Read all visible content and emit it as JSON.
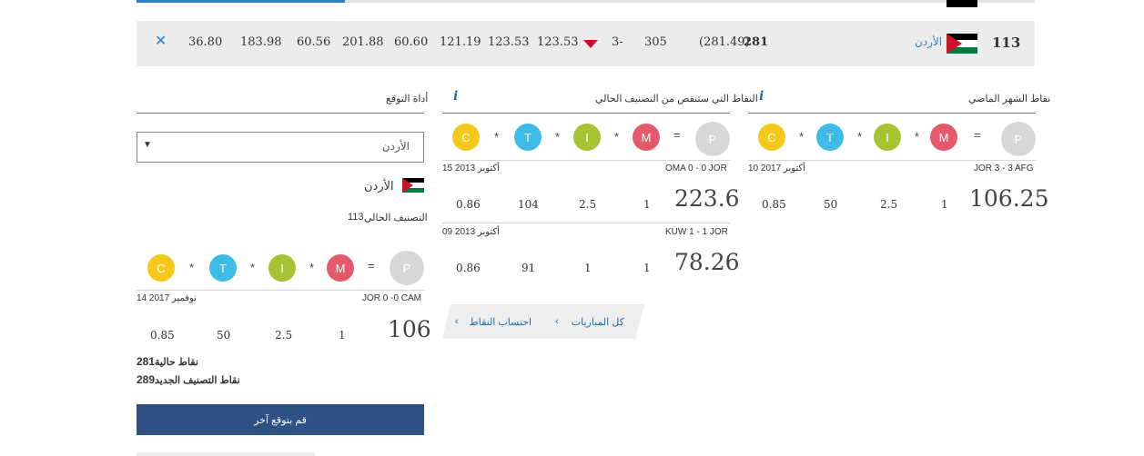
{
  "rank_row": {
    "close_icon": "close-icon",
    "values": [
      "36.80",
      "183.98",
      "60.56",
      "201.88",
      "60.60",
      "121.19",
      "123.53",
      "123.53"
    ],
    "arrow": "down-arrow-icon",
    "movement": "3-",
    "previous_points": "305",
    "points_old": "(281.49)",
    "points": "281",
    "country": "الأردن",
    "rank": "113"
  },
  "formula": {
    "c": "C",
    "t": "T",
    "i": "I",
    "m": "M",
    "p": "P",
    "times": "*",
    "equals": "="
  },
  "panels": {
    "last_month": {
      "title": "نقاط الشهر الماضي",
      "info": "i",
      "matches": [
        {
          "date": "10 أكتوبر 2017",
          "teams": "JOR 3 - 3 AFG",
          "c": "0.85",
          "t": "50",
          "i": "2.5",
          "m": "1",
          "p": "106.25"
        }
      ]
    },
    "deducted": {
      "title": "النقاط التي ستنقص من التصنيف الحالي",
      "info": "i",
      "matches": [
        {
          "date": "15 أكتوبر 2013",
          "teams": "OMA 0 - 0 JOR",
          "c": "0.86",
          "t": "104",
          "i": "2.5",
          "m": "1",
          "p": "223.6"
        },
        {
          "date": "09 أكتوبر 2013",
          "teams": "KUW 1 - 1 JOR",
          "c": "0.86",
          "t": "91",
          "i": "1",
          "m": "1",
          "p": "78.26"
        }
      ],
      "tabs": [
        "كل المباريات",
        "احتساب النقاط"
      ]
    },
    "predictor": {
      "title": "أداة التوقع",
      "select_value": "الأردن",
      "country": "الأردن",
      "current_rank_label": "التصنيف الحالي",
      "current_rank": "113",
      "match": {
        "date": "14 نوفمبر 2017",
        "teams": "JOR 0 -0 CAM",
        "c": "0.85",
        "t": "50",
        "i": "2.5",
        "m": "1",
        "p": "106"
      },
      "current_points_label": "نقاط حالية",
      "current_points": "281",
      "new_points_label": "نقاط التصنيف الجديد",
      "new_points": "289",
      "button": "قم بتوقع آخر"
    }
  },
  "colors": {
    "blue": "#2f80c8",
    "button": "#2f5184",
    "row_bg": "#ececec",
    "yellow": "#f7c81c",
    "cyan": "#3ebbe6",
    "green": "#a8c331",
    "red": "#e55a6a",
    "grey": "#d7d7d7"
  }
}
